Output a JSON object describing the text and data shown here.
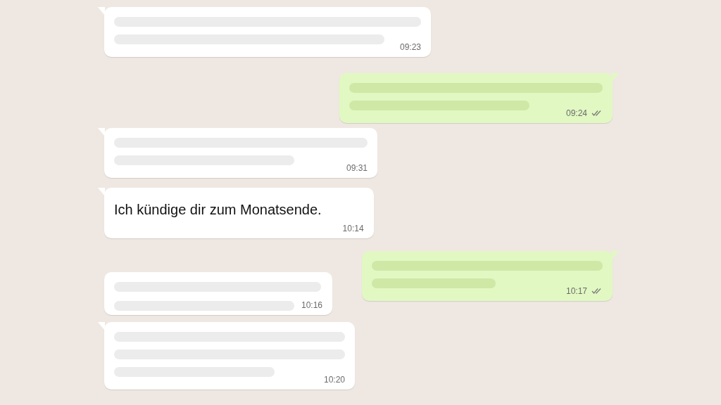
{
  "messages": [
    {
      "kind": "incoming",
      "tail": true,
      "lines": [
        {
          "kind": "full"
        },
        {
          "kind": "long"
        }
      ],
      "time": "09:23",
      "time_inline": false
    },
    {
      "kind": "outgoing",
      "tail": true,
      "lines": [
        {
          "kind": "wide"
        },
        {
          "kind": "half"
        }
      ],
      "time": "09:24",
      "time_inline": false,
      "read": true
    },
    {
      "kind": "incoming",
      "tail": true,
      "lines": [
        {
          "kind": "wide"
        },
        {
          "kind": "half"
        }
      ],
      "time": "09:31",
      "time_inline": false
    },
    {
      "kind": "incoming",
      "tail": true,
      "text": "Ich kündige dir zum Monatsende.",
      "time": "10:14",
      "time_inline": false
    },
    {
      "kind": "outgoing",
      "tail": true,
      "lines": [
        {
          "kind": "mid"
        },
        {
          "kind": "short"
        }
      ],
      "time": "10:17",
      "time_inline": false,
      "read": true
    },
    {
      "kind": "incoming",
      "tail": false,
      "lines": [
        {
          "kind": "narrow"
        },
        {
          "kind": "half"
        }
      ],
      "time": "10:16",
      "time_inline": true
    },
    {
      "kind": "incoming",
      "tail": true,
      "lines": [
        {
          "kind": "mid"
        },
        {
          "kind": "mid"
        },
        {
          "kind": "third"
        }
      ],
      "time": "10:20",
      "time_inline": false
    }
  ]
}
